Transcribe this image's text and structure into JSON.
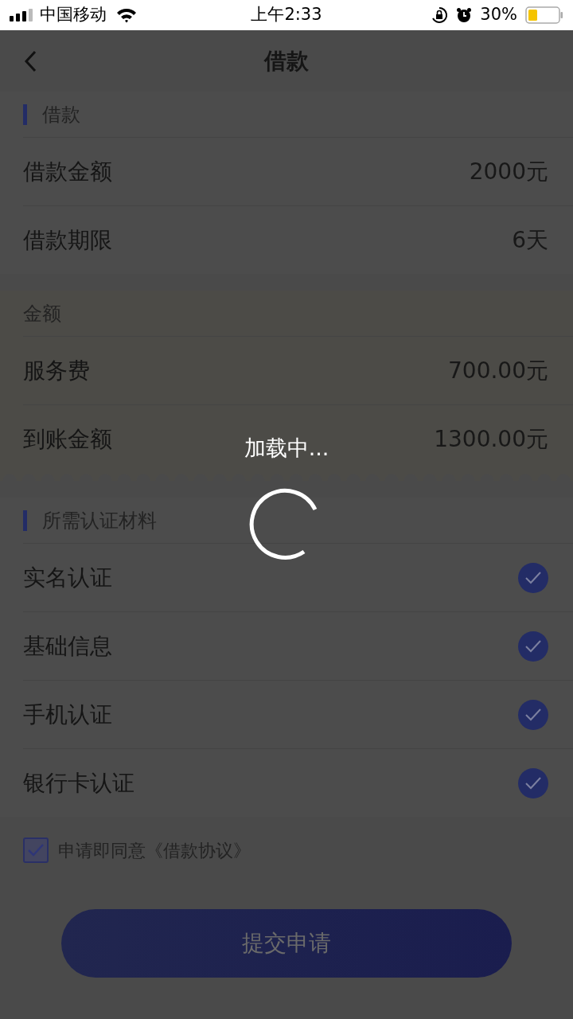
{
  "status_bar": {
    "carrier": "中国移动",
    "time": "上午2:33",
    "battery": "30%"
  },
  "nav": {
    "title": "借款"
  },
  "sections": [
    {
      "title": "借款",
      "marked": true,
      "scalloped": false,
      "rows": [
        {
          "kind": "value",
          "label": "借款金额",
          "value": "2000元"
        },
        {
          "kind": "value",
          "label": "借款期限",
          "value": "6天"
        }
      ]
    },
    {
      "title": "金额",
      "marked": false,
      "scalloped": true,
      "rows": [
        {
          "kind": "value",
          "label": "服务费",
          "value": "700.00元"
        },
        {
          "kind": "value",
          "label": "到账金额",
          "value": "1300.00元"
        }
      ]
    },
    {
      "title": "所需认证材料",
      "marked": true,
      "scalloped": false,
      "rows": [
        {
          "kind": "check",
          "label": "实名认证",
          "checked": true
        },
        {
          "kind": "check",
          "label": "基础信息",
          "checked": true
        },
        {
          "kind": "check",
          "label": "手机认证",
          "checked": true
        },
        {
          "kind": "check",
          "label": "银行卡认证",
          "checked": true
        }
      ]
    }
  ],
  "agreement": {
    "text": "申请即同意《借款协议》",
    "checked": true
  },
  "submit_button": {
    "label": "提交申请"
  },
  "loading": {
    "text": "加载中..."
  }
}
